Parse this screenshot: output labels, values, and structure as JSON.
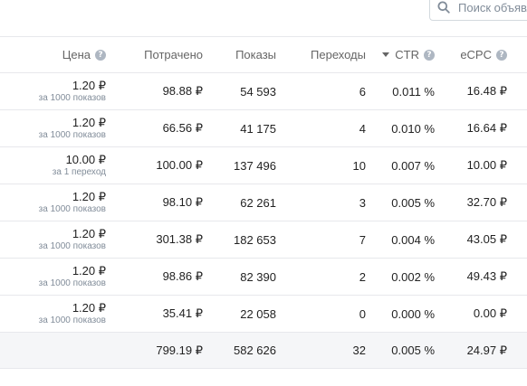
{
  "search": {
    "placeholder": "Поиск объявл"
  },
  "headers": {
    "price": "Цена",
    "spent": "Потрачено",
    "shows": "Показы",
    "clicks": "Переходы",
    "ctr": "CTR",
    "ecpc": "eCPC"
  },
  "rows": [
    {
      "price": "1.20 ₽",
      "price_note": "за 1000 показов",
      "spent": "98.88 ₽",
      "shows": "54 593",
      "clicks": "6",
      "ctr": "0.011 %",
      "ecpc": "16.48 ₽"
    },
    {
      "price": "1.20 ₽",
      "price_note": "за 1000 показов",
      "spent": "66.56 ₽",
      "shows": "41 175",
      "clicks": "4",
      "ctr": "0.010 %",
      "ecpc": "16.64 ₽"
    },
    {
      "price": "10.00 ₽",
      "price_note": "за 1 переход",
      "spent": "100.00 ₽",
      "shows": "137 496",
      "clicks": "10",
      "ctr": "0.007 %",
      "ecpc": "10.00 ₽"
    },
    {
      "price": "1.20 ₽",
      "price_note": "за 1000 показов",
      "spent": "98.10 ₽",
      "shows": "62 261",
      "clicks": "3",
      "ctr": "0.005 %",
      "ecpc": "32.70 ₽"
    },
    {
      "price": "1.20 ₽",
      "price_note": "за 1000 показов",
      "spent": "301.38 ₽",
      "shows": "182 653",
      "clicks": "7",
      "ctr": "0.004 %",
      "ecpc": "43.05 ₽"
    },
    {
      "price": "1.20 ₽",
      "price_note": "за 1000 показов",
      "spent": "98.86 ₽",
      "shows": "82 390",
      "clicks": "2",
      "ctr": "0.002 %",
      "ecpc": "49.43 ₽"
    },
    {
      "price": "1.20 ₽",
      "price_note": "за 1000 показов",
      "spent": "35.41 ₽",
      "shows": "22 058",
      "clicks": "0",
      "ctr": "0.000 %",
      "ecpc": "0.00 ₽"
    }
  ],
  "totals": {
    "spent": "799.19 ₽",
    "shows": "582 626",
    "clicks": "32",
    "ctr": "0.005 %",
    "ecpc": "24.97 ₽"
  },
  "icons": {
    "search": "search-icon",
    "help": "question-circle-icon",
    "sort": "sort-desc-icon"
  }
}
